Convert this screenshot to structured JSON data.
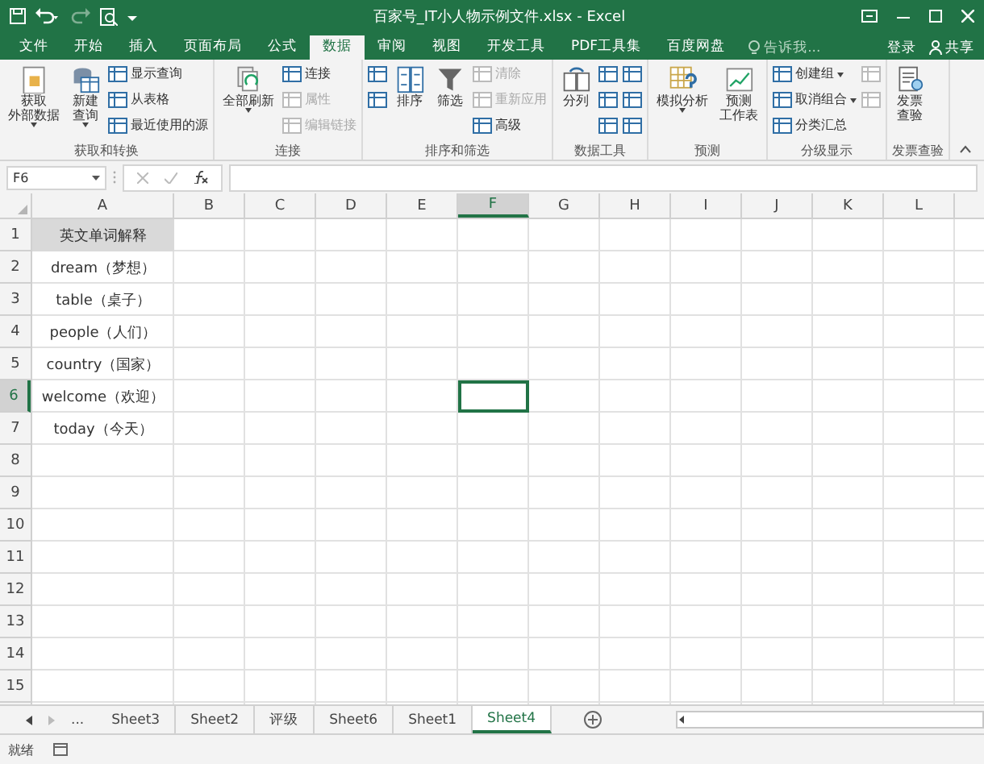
{
  "window": {
    "title": "百家号_IT小人物示例文件.xlsx - Excel"
  },
  "ribbon_tabs": [
    {
      "label": "文件",
      "selected": false
    },
    {
      "label": "开始",
      "selected": false
    },
    {
      "label": "插入",
      "selected": false
    },
    {
      "label": "页面布局",
      "selected": false
    },
    {
      "label": "公式",
      "selected": false
    },
    {
      "label": "数据",
      "selected": true
    },
    {
      "label": "审阅",
      "selected": false
    },
    {
      "label": "视图",
      "selected": false
    },
    {
      "label": "开发工具",
      "selected": false
    },
    {
      "label": "PDF工具集",
      "selected": false
    },
    {
      "label": "百度网盘",
      "selected": false
    }
  ],
  "tell_me": {
    "placeholder": "告诉我..."
  },
  "account": {
    "sign_in": "登录",
    "share": "共享"
  },
  "ribbon_groups": [
    {
      "label": "获取和转换",
      "items": [
        {
          "kind": "large",
          "lines": [
            "获取",
            "外部数据"
          ],
          "dropdown": true,
          "disabled": false
        },
        {
          "kind": "large",
          "lines": [
            "新建",
            "查询"
          ],
          "dropdown": true,
          "disabled": false
        },
        {
          "kind": "small",
          "label": "显示查询",
          "disabled": false
        },
        {
          "kind": "small",
          "label": "从表格",
          "disabled": false
        },
        {
          "kind": "small",
          "label": "最近使用的源",
          "disabled": false
        }
      ]
    },
    {
      "label": "连接",
      "items": [
        {
          "kind": "large",
          "lines": [
            "全部刷新"
          ],
          "dropdown": true,
          "disabled": false
        },
        {
          "kind": "small",
          "label": "连接",
          "disabled": false
        },
        {
          "kind": "small",
          "label": "属性",
          "disabled": true
        },
        {
          "kind": "small",
          "label": "编辑链接",
          "disabled": true
        }
      ]
    },
    {
      "label": "排序和筛选",
      "items": [
        {
          "kind": "icon",
          "disabled": false
        },
        {
          "kind": "icon",
          "disabled": false
        },
        {
          "kind": "large",
          "lines": [
            "排序"
          ],
          "dropdown": false,
          "disabled": false
        },
        {
          "kind": "large",
          "lines": [
            "筛选"
          ],
          "dropdown": false,
          "disabled": false
        },
        {
          "kind": "small",
          "label": "清除",
          "disabled": true
        },
        {
          "kind": "small",
          "label": "重新应用",
          "disabled": true
        },
        {
          "kind": "small",
          "label": "高级",
          "disabled": false
        }
      ]
    },
    {
      "label": "数据工具",
      "items": [
        {
          "kind": "large",
          "lines": [
            "分列"
          ],
          "dropdown": false,
          "disabled": false
        },
        {
          "kind": "icon",
          "disabled": false
        },
        {
          "kind": "icon",
          "disabled": false
        },
        {
          "kind": "icon",
          "disabled": false
        },
        {
          "kind": "icon",
          "disabled": false
        },
        {
          "kind": "icon",
          "disabled": false
        },
        {
          "kind": "icon",
          "disabled": false
        }
      ]
    },
    {
      "label": "预测",
      "items": [
        {
          "kind": "large",
          "lines": [
            "模拟分析"
          ],
          "dropdown": true,
          "disabled": false
        },
        {
          "kind": "large",
          "lines": [
            "预测",
            "工作表"
          ],
          "dropdown": false,
          "disabled": false
        }
      ]
    },
    {
      "label": "分级显示",
      "items": [
        {
          "kind": "small",
          "label": "创建组",
          "dropdown": true,
          "disabled": false
        },
        {
          "kind": "small",
          "label": "取消组合",
          "dropdown": true,
          "disabled": false
        },
        {
          "kind": "small",
          "label": "分类汇总",
          "disabled": false
        },
        {
          "kind": "icon",
          "disabled": true
        },
        {
          "kind": "icon",
          "disabled": true
        }
      ]
    },
    {
      "label": "发票查验",
      "items": [
        {
          "kind": "large",
          "lines": [
            "发票",
            "查验"
          ],
          "dropdown": false,
          "disabled": false
        }
      ]
    }
  ],
  "name_box": {
    "value": "F6"
  },
  "columns": [
    {
      "label": "A",
      "selected": false
    },
    {
      "label": "B",
      "selected": false
    },
    {
      "label": "C",
      "selected": false
    },
    {
      "label": "D",
      "selected": false
    },
    {
      "label": "E",
      "selected": false
    },
    {
      "label": "F",
      "selected": true
    },
    {
      "label": "G",
      "selected": false
    },
    {
      "label": "H",
      "selected": false
    },
    {
      "label": "I",
      "selected": false
    },
    {
      "label": "J",
      "selected": false
    },
    {
      "label": "K",
      "selected": false
    },
    {
      "label": "L",
      "selected": false
    }
  ],
  "rows": [
    {
      "label": "1",
      "selected": false,
      "kind": "heading",
      "cells": [
        "英文单词解释"
      ]
    },
    {
      "label": "2",
      "selected": false,
      "kind": "data",
      "cells": [
        "dream（梦想）"
      ]
    },
    {
      "label": "3",
      "selected": false,
      "kind": "data",
      "cells": [
        "table（桌子）"
      ]
    },
    {
      "label": "4",
      "selected": false,
      "kind": "data",
      "cells": [
        "people（人们）"
      ]
    },
    {
      "label": "5",
      "selected": false,
      "kind": "data",
      "cells": [
        "country（国家）"
      ]
    },
    {
      "label": "6",
      "selected": true,
      "kind": "data",
      "cells": [
        "welcome（欢迎）"
      ]
    },
    {
      "label": "7",
      "selected": false,
      "kind": "data",
      "cells": [
        "today（今天）"
      ]
    },
    {
      "label": "8",
      "selected": false
    },
    {
      "label": "9",
      "selected": false
    },
    {
      "label": "10",
      "selected": false
    },
    {
      "label": "11",
      "selected": false
    },
    {
      "label": "12",
      "selected": false
    },
    {
      "label": "13",
      "selected": false
    },
    {
      "label": "14",
      "selected": false
    },
    {
      "label": "15",
      "selected": false
    }
  ],
  "sheet_nav": {
    "more": "..."
  },
  "sheets": [
    {
      "label": "Sheet3",
      "selected": false
    },
    {
      "label": "Sheet2",
      "selected": false
    },
    {
      "label": "评级",
      "selected": false
    },
    {
      "label": "Sheet6",
      "selected": false
    },
    {
      "label": "Sheet1",
      "selected": false
    },
    {
      "label": "Sheet4",
      "selected": true
    }
  ],
  "status_bar": {
    "text": "就绪"
  }
}
